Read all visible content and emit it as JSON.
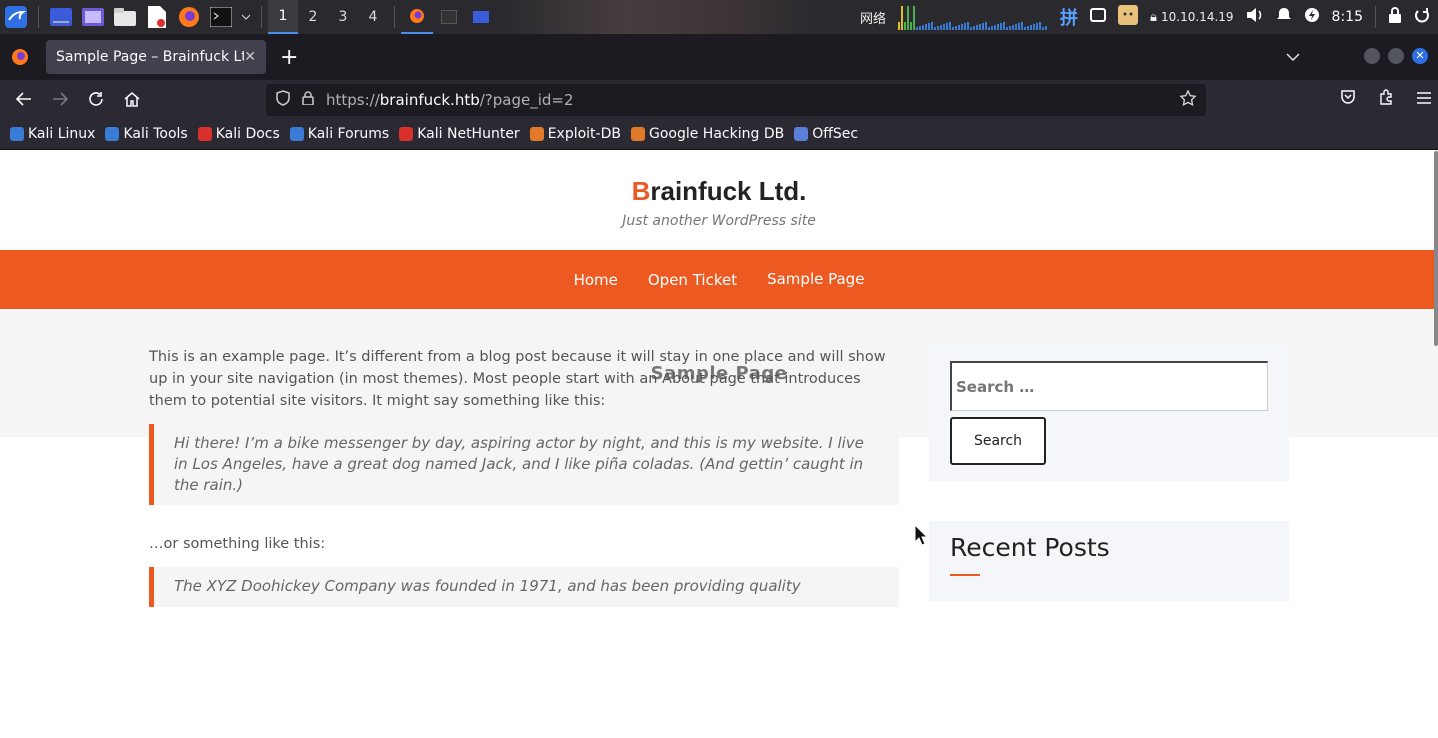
{
  "taskbar": {
    "workspaces": [
      "1",
      "2",
      "3",
      "4"
    ],
    "active_workspace": "1",
    "network_label": "网络",
    "ime_label": "拼",
    "ip": "10.10.14.19",
    "clock": "8:15",
    "accent": "#4a8ef0"
  },
  "browser": {
    "tab_title": "Sample Page – Brainfuck Ltd.",
    "url_scheme": "https://",
    "url_host": "brainfuck.htb",
    "url_rest": "/?page_id=2",
    "bookmarks": [
      {
        "label": "Kali Linux",
        "icon": "kali-icon",
        "color": "#3a7bd5"
      },
      {
        "label": "Kali Tools",
        "icon": "kali-tools-icon",
        "color": "#3a7bd5"
      },
      {
        "label": "Kali Docs",
        "icon": "docs-icon",
        "color": "#d9302c"
      },
      {
        "label": "Kali Forums",
        "icon": "forums-icon",
        "color": "#3a7bd5"
      },
      {
        "label": "Kali NetHunter",
        "icon": "nethunter-icon",
        "color": "#d9302c"
      },
      {
        "label": "Exploit-DB",
        "icon": "exploitdb-icon",
        "color": "#e07a2a"
      },
      {
        "label": "Google Hacking DB",
        "icon": "ghdb-icon",
        "color": "#e07a2a"
      },
      {
        "label": "OffSec",
        "icon": "offsec-icon",
        "color": "#5a7fd8"
      }
    ]
  },
  "site": {
    "title_first": "B",
    "title_rest": "rainfuck Ltd.",
    "tagline": "Just another WordPress site",
    "menu": [
      "Home",
      "Open Ticket",
      "Sample Page"
    ],
    "brand_color": "#ec5a21",
    "page_title": "Sample Page",
    "content": {
      "p1": "This is an example page. It’s different from a blog post because it will stay in one place and will show up in your site navigation (in most themes). Most people start with an About page that introduces them to potential site visitors. It might say something like this:",
      "quote1": "Hi there! I’m a bike messenger by day, aspiring actor by night, and this is my website. I live in Los Angeles, have a great dog named Jack, and I like piña coladas. (And gettin’ caught in the rain.)",
      "p2": "…or something like this:",
      "quote2": "The XYZ Doohickey Company was founded in 1971, and has been providing quality"
    },
    "sidebar": {
      "search_placeholder": "Search …",
      "search_button": "Search",
      "recent_posts_title": "Recent Posts"
    }
  }
}
